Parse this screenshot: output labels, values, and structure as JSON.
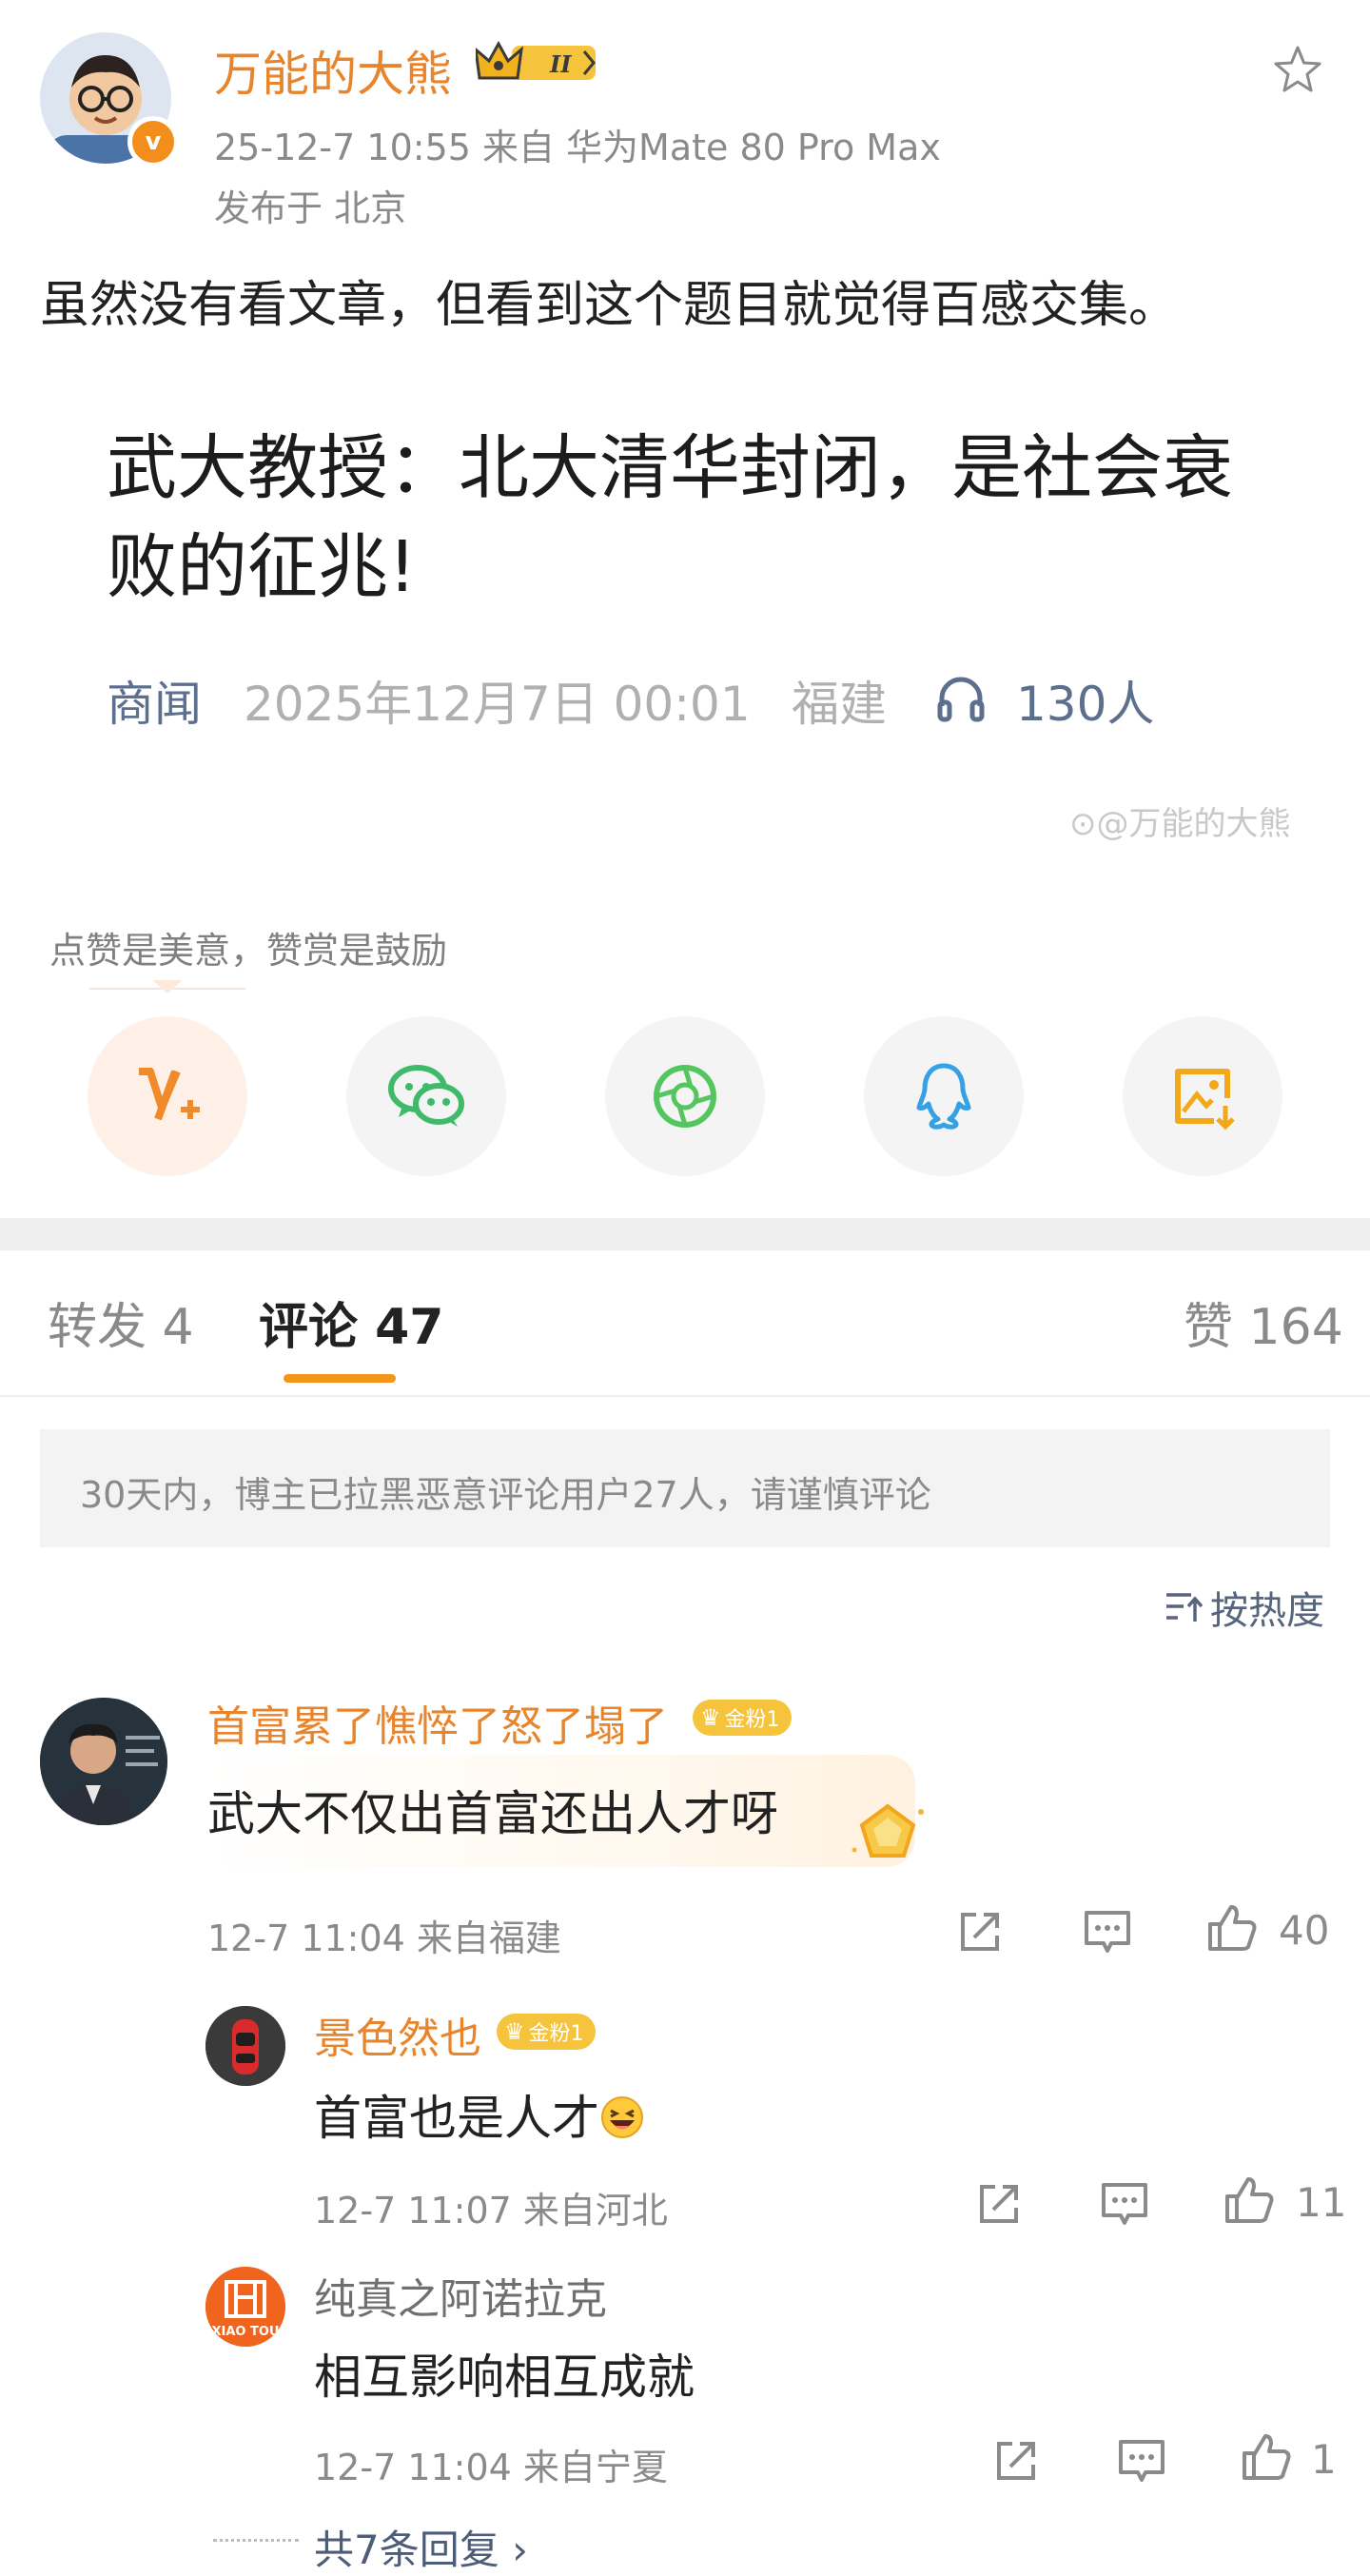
{
  "post": {
    "author": "万能的大熊",
    "level_badge": "II",
    "time_source": "25-12-7 10:55   来自 华为Mate 80 Pro Max",
    "location": "发布于 北京",
    "text": "虽然没有看文章，但看到这个题目就觉得百感交集。",
    "verified_mark": "v",
    "avatar_icon": "cartoon-bear-avatar",
    "favorite_icon": "star-outline-icon"
  },
  "article": {
    "headline": "武大教授：北大清华封闭，是社会衰败的征兆!",
    "source": "商闻",
    "date": "2025年12月7日 00:01",
    "province": "福建",
    "listeners": "130人",
    "watermark": "@万能的大熊"
  },
  "reward": {
    "note": "点赞是美意，赞赏是鼓励",
    "share_buttons": [
      {
        "name": "v-plus-reward",
        "color": "#f08a2a"
      },
      {
        "name": "wechat",
        "color": "#3fba6a"
      },
      {
        "name": "wechat-moments",
        "color": "#54c65f"
      },
      {
        "name": "qq",
        "color": "#35a0e4"
      },
      {
        "name": "save-image",
        "color": "#f2a818"
      }
    ]
  },
  "tabs": {
    "repost": "转发 4",
    "comments": "评论 47",
    "likes": "赞 164"
  },
  "notice": "30天内，博主已拉黑恶意评论用户27人，请谨慎评论",
  "sort_label": "按热度",
  "comments": [
    {
      "name": "首富累了憔悴了怒了塌了",
      "badge": "金粉1",
      "text": "武大不仅出首富还出人才呀",
      "meta": "12-7 11:04  来自福建",
      "likes": "40"
    },
    {
      "name": "景色然也",
      "badge": "金粉1",
      "text": "首富也是人才",
      "meta": "12-7 11:07  来自河北",
      "likes": "11"
    },
    {
      "name": "纯真之阿诺拉克",
      "text": "相互影响相互成就",
      "meta": "12-7 11:04  来自宁夏",
      "likes": "1",
      "avatar_text": "XIAO TOU"
    }
  ],
  "more_replies": "共7条回复 ›",
  "colors": {
    "accent_orange": "#e8842b",
    "tab_underline": "#f29518",
    "link_blue": "#5c6f8f"
  }
}
